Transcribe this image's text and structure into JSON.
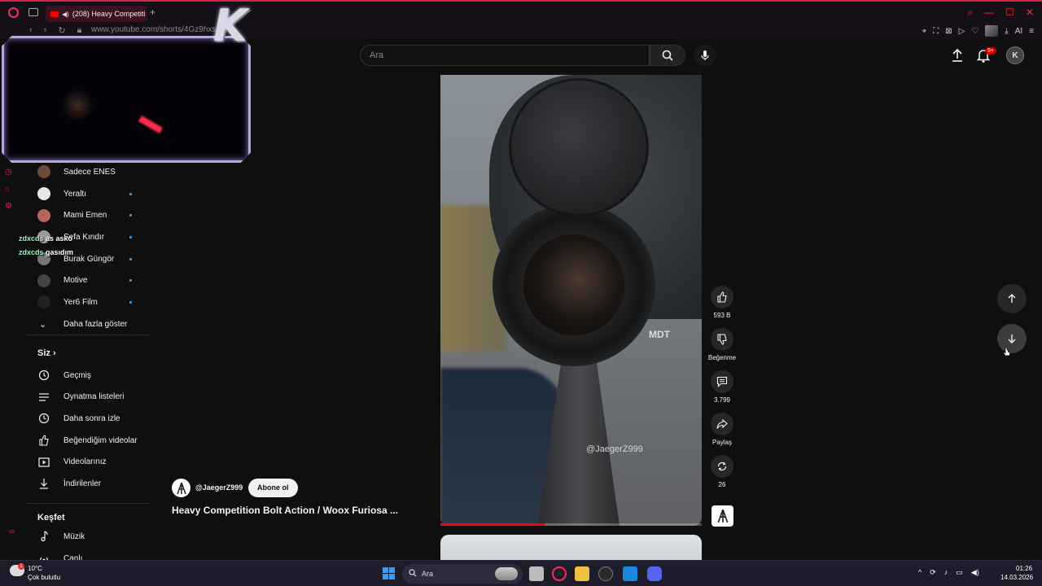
{
  "browser": {
    "tab_title": "(208) Heavy Competiti",
    "url": "www.youtube.com/shorts/4Gz9hxs",
    "ai_label": "AI"
  },
  "header": {
    "search_placeholder": "Ara",
    "notification_count": "9+"
  },
  "chat": [
    {
      "user": "zdxcds",
      "message": "as asko"
    },
    {
      "user": "zdxcds",
      "message": "gasıdım"
    }
  ],
  "sidebar": {
    "subscriptions": [
      {
        "name": "Sadece ENES"
      },
      {
        "name": "Yeraltı"
      },
      {
        "name": "Mami Emen"
      },
      {
        "name": "Sefa Kındır"
      },
      {
        "name": "Burak Güngör"
      },
      {
        "name": "Motive"
      },
      {
        "name": "Yer6 Film"
      }
    ],
    "show_more": "Daha fazla göster",
    "you_section": "Siz",
    "you_items": [
      {
        "label": "Geçmiş",
        "icon": "history-icon"
      },
      {
        "label": "Oynatma listeleri",
        "icon": "playlist-icon"
      },
      {
        "label": "Daha sonra izle",
        "icon": "clock-icon"
      },
      {
        "label": "Beğendiğim videolar",
        "icon": "thumbs-up-icon"
      },
      {
        "label": "Videolarınız",
        "icon": "play-box-icon"
      },
      {
        "label": "İndirilenler",
        "icon": "download-icon"
      }
    ],
    "explore_section": "Keşfet",
    "explore_items": [
      {
        "label": "Müzik",
        "icon": "music-icon"
      },
      {
        "label": "Canlı",
        "icon": "live-icon"
      }
    ],
    "rail_label": "ux"
  },
  "video": {
    "watermark": "@JaegerZ999",
    "overlay_text": "MDT",
    "progress": 0.4,
    "channel": "@JaegerZ999",
    "subscribe_label": "Abone ol",
    "title": "Heavy Competition Bolt Action / Woox Furiosa ..."
  },
  "actions": {
    "like_count": "593 B",
    "dislike_label": "Beğenme",
    "comment_count": "3.799",
    "share_label": "Paylaş",
    "remix_count": "26"
  },
  "taskbar": {
    "weather_temp": "10°C",
    "weather_desc": "Çok bulutlu",
    "weather_badge": "1",
    "search_label": "Ara",
    "time": "01:26",
    "date": "14.03.2026"
  },
  "colors": {
    "accent": "#ff0000",
    "browser_accent": "#d0264a",
    "link_dot": "#3ea6ff"
  }
}
